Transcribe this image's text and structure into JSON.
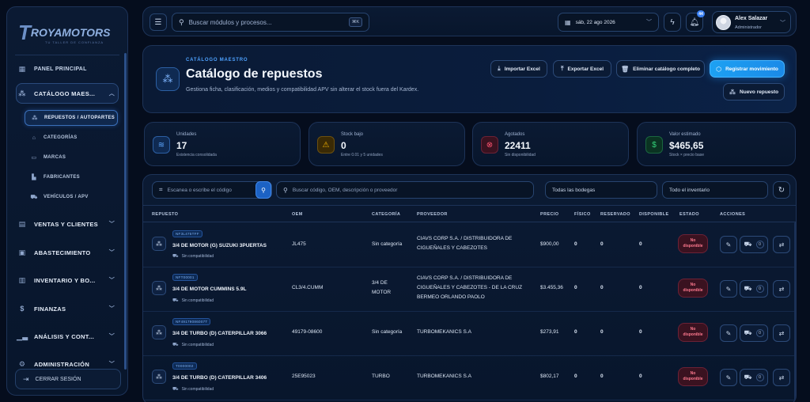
{
  "brand": {
    "logo_mark": "T",
    "logo_text": "ROYAMOTORS",
    "logo_sub": "TU TALLER DE CONFIANZA"
  },
  "sidebar": {
    "panel_principal": "PANEL PRINCIPAL",
    "groups": [
      {
        "label": "CATÁLOGO MAES...",
        "icon": "cubes-icon"
      },
      {
        "label": "VENTAS Y CLIENTES",
        "icon": "clipboard-icon"
      },
      {
        "label": "ABASTECIMIENTO",
        "icon": "clipboard-list-icon"
      },
      {
        "label": "INVENTARIO Y BO...",
        "icon": "warehouse-icon"
      },
      {
        "label": "FINANZAS",
        "icon": "dollar-icon"
      },
      {
        "label": "ANÁLISIS Y CONT...",
        "icon": "chart-icon"
      },
      {
        "label": "ADMINISTRACIÓN",
        "icon": "gear-icon"
      }
    ],
    "subitems": [
      {
        "label": "REPUESTOS / AUTOPARTES",
        "active": true
      },
      {
        "label": "CATEGORÍAS"
      },
      {
        "label": "MARCAS"
      },
      {
        "label": "FABRICANTES"
      },
      {
        "label": "VEHÍCULOS / APV"
      }
    ],
    "logout": "CERRAR SESIÓN"
  },
  "topbar": {
    "search_placeholder": "Buscar módulos y procesos...",
    "shortcut": "⌘K",
    "date": "sáb, 22 ago 2026",
    "notifications": "44",
    "user_name": "Alex Salazar",
    "user_role": "Administrador"
  },
  "header": {
    "kicker": "CATÁLOGO MAESTRO",
    "title": "Catálogo de repuestos",
    "description": "Gestiona ficha, clasificación, medios y compatibilidad APV sin alterar el stock fuera del Kardex.",
    "buttons": {
      "import": "Importar Excel",
      "export": "Exportar Excel",
      "delete_all": "Eliminar catálogo completo",
      "register": "Registrar movimiento",
      "new": "Nuevo repuesto"
    }
  },
  "stats": [
    {
      "label": "Unidades",
      "value": "17",
      "sub": "Existencia consolidada",
      "color": "#3b82f6"
    },
    {
      "label": "Stock bajo",
      "value": "0",
      "sub": "Entre 0.01 y 5 unidades",
      "color": "#f5b301"
    },
    {
      "label": "Agotados",
      "value": "22411",
      "sub": "Sin disponibilidad",
      "color": "#ef4466"
    },
    {
      "label": "Valor estimado",
      "value": "$465,65",
      "sub": "Stock × precio base",
      "color": "#22c55e"
    }
  ],
  "filters": {
    "scan_placeholder": "Escanea o escribe el código",
    "search_placeholder": "Buscar código, OEM, descripción o proveedor",
    "warehouse": "Todas las bodegas",
    "inventory": "Todo el inventario"
  },
  "table": {
    "headers": {
      "repuesto": "REPUESTO",
      "oem": "OEM",
      "categoria": "CATEGORÍA",
      "proveedor": "PROVEEDOR",
      "precio": "PRECIO",
      "fisico": "FÍSICO",
      "reservado": "RESERVADO",
      "disponible": "DISPONIBLE",
      "estado": "ESTADO",
      "acciones": "ACCIONES"
    },
    "compat_label": "Sin compatibilidad",
    "rows": [
      {
        "code": "NF3L475TFF",
        "name": "3/4 DE MOTOR (G) SUZUKI 3PUERTAS",
        "oem": "JL475",
        "categoria": [
          "Sin categoría"
        ],
        "proveedor": [
          "CIAVS CORP S.A. / DISTRIBUIDORA DE",
          "CIGUEÑALES Y CABEZOTES"
        ],
        "precio": "$900,00",
        "fisico": "0",
        "reservado": "0",
        "disponible": "0",
        "estado": [
          "No",
          "disponible"
        ],
        "vehiculos": "0"
      },
      {
        "code": "NFT00001",
        "name": "3/4 DE MOTOR CUMMINS 5.9L",
        "oem": "CL3/4.CUMM",
        "categoria": [
          "3/4 DE",
          "MOTOR"
        ],
        "proveedor": [
          "CIAVS CORP S.A. / DISTRIBUIDORA DE",
          "CIGUEÑALES Y CABEZOTES - DE LA CRUZ",
          "BERMEO ORLANDO PAOLO"
        ],
        "precio": "$3.455,36",
        "fisico": "0",
        "reservado": "0",
        "disponible": "0",
        "estado": [
          "No",
          "disponible"
        ],
        "vehiculos": "0"
      },
      {
        "code": "NF49179086007T",
        "name": "3/4 DE TURBO (D) CATERPILLAR 3066",
        "oem": "49179-08600",
        "categoria": [
          "Sin categoría"
        ],
        "proveedor": [
          "TURBOMEKANICS S.A"
        ],
        "precio": "$273,91",
        "fisico": "0",
        "reservado": "0",
        "disponible": "0",
        "estado": [
          "No",
          "disponible"
        ],
        "vehiculos": "0"
      },
      {
        "code": "T0000002",
        "name": "3/4 DE TURBO (D) CATERPILLAR 3406",
        "oem": "25E95023",
        "categoria": [
          "TURBO"
        ],
        "proveedor": [
          "TURBOMEKANICS S.A"
        ],
        "precio": "$802,17",
        "fisico": "0",
        "reservado": "0",
        "disponible": "0",
        "estado": [
          "No",
          "disponible"
        ],
        "vehiculos": "0"
      }
    ]
  }
}
